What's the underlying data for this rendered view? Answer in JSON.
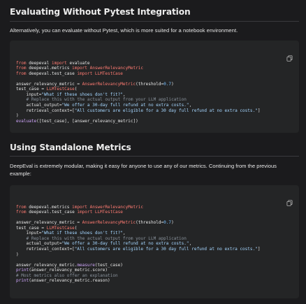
{
  "section1": {
    "title": "Evaluating Without Pytest Integration",
    "description": "Alternatively, you can evaluate without Pytest, which is more suited for a notebook environment.",
    "code": [
      [
        [
          "kw",
          "from"
        ],
        [
          "pl",
          " deepeval "
        ],
        [
          "kw",
          "import"
        ],
        [
          "pl",
          " evaluate"
        ]
      ],
      [
        [
          "kw",
          "from"
        ],
        [
          "pl",
          " deepeval.metrics "
        ],
        [
          "kw",
          "import"
        ],
        [
          "cls",
          " AnswerRelevancyMetric"
        ]
      ],
      [
        [
          "kw",
          "from"
        ],
        [
          "pl",
          " deepeval.test_case "
        ],
        [
          "kw",
          "import"
        ],
        [
          "cls",
          " LLMTestCase"
        ]
      ],
      [],
      [
        [
          "pl",
          "answer_relevancy_metric "
        ],
        [
          "op",
          "="
        ],
        [
          "cls",
          " AnswerRelevancyMetric"
        ],
        [
          "pl",
          "(threshold"
        ],
        [
          "op",
          "="
        ],
        [
          "num",
          "0.7"
        ],
        [
          "pl",
          ")"
        ]
      ],
      [
        [
          "pl",
          "test_case "
        ],
        [
          "op",
          "="
        ],
        [
          "cls",
          " LLMTestCase"
        ],
        [
          "pl",
          "("
        ]
      ],
      [
        [
          "pl",
          "    input"
        ],
        [
          "op",
          "="
        ],
        [
          "str",
          "\"What if these shoes don't fit?\""
        ],
        [
          "pl",
          ","
        ]
      ],
      [
        [
          "cm",
          "    # Replace this with the actual output from your LLM application"
        ]
      ],
      [
        [
          "pl",
          "    actual_output"
        ],
        [
          "op",
          "="
        ],
        [
          "str",
          "\"We offer a 30-day full refund at no extra costs.\""
        ],
        [
          "pl",
          ","
        ]
      ],
      [
        [
          "pl",
          "    retrieval_context"
        ],
        [
          "op",
          "="
        ],
        [
          "pl",
          "["
        ],
        [
          "str",
          "\"All customers are eligible for a 30 day full refund at no extra costs.\""
        ],
        [
          "pl",
          "]"
        ]
      ],
      [
        [
          "pl",
          ")"
        ]
      ],
      [
        [
          "fn",
          "evaluate"
        ],
        [
          "pl",
          "([test_case], [answer_relevancy_metric])"
        ]
      ]
    ]
  },
  "section2": {
    "title": "Using Standalone Metrics",
    "description": "DeepEval is extremely modular, making it easy for anyone to use any of our metrics. Continuing from the previous example:",
    "code": [
      [
        [
          "kw",
          "from"
        ],
        [
          "pl",
          " deepeval.metrics "
        ],
        [
          "kw",
          "import"
        ],
        [
          "cls",
          " AnswerRelevancyMetric"
        ]
      ],
      [
        [
          "kw",
          "from"
        ],
        [
          "pl",
          " deepeval.test_case "
        ],
        [
          "kw",
          "import"
        ],
        [
          "cls",
          " LLMTestCase"
        ]
      ],
      [],
      [
        [
          "pl",
          "answer_relevancy_metric "
        ],
        [
          "op",
          "="
        ],
        [
          "cls",
          " AnswerRelevancyMetric"
        ],
        [
          "pl",
          "(threshold"
        ],
        [
          "op",
          "="
        ],
        [
          "num",
          "0.7"
        ],
        [
          "pl",
          ")"
        ]
      ],
      [
        [
          "pl",
          "test_case "
        ],
        [
          "op",
          "="
        ],
        [
          "cls",
          " LLMTestCase"
        ],
        [
          "pl",
          "("
        ]
      ],
      [
        [
          "pl",
          "    input"
        ],
        [
          "op",
          "="
        ],
        [
          "str",
          "\"What if these shoes don't fit?\""
        ],
        [
          "pl",
          ","
        ]
      ],
      [
        [
          "cm",
          "    # Replace this with the actual output from your LLM application"
        ]
      ],
      [
        [
          "pl",
          "    actual_output"
        ],
        [
          "op",
          "="
        ],
        [
          "str",
          "\"We offer a 30-day full refund at no extra costs.\""
        ],
        [
          "pl",
          ","
        ]
      ],
      [
        [
          "pl",
          "    retrieval_context"
        ],
        [
          "op",
          "="
        ],
        [
          "pl",
          "["
        ],
        [
          "str",
          "\"All customers are eligible for a 30 day full refund at no extra costs.\""
        ],
        [
          "pl",
          "]"
        ]
      ],
      [
        [
          "pl",
          ")"
        ]
      ],
      [],
      [
        [
          "pl",
          "answer_relevancy_metric."
        ],
        [
          "fn",
          "measure"
        ],
        [
          "pl",
          "(test_case)"
        ]
      ],
      [
        [
          "fn",
          "print"
        ],
        [
          "pl",
          "(answer_relevancy_metric.score)"
        ]
      ],
      [
        [
          "cm",
          "# Most metrics also offer an explanation"
        ]
      ],
      [
        [
          "fn",
          "print"
        ],
        [
          "pl",
          "(answer_relevancy_metric.reason)"
        ]
      ]
    ]
  },
  "icons": {
    "copy": "copy-icon"
  },
  "colors": {
    "background": "#1b1b1d",
    "code_background": "#242526",
    "keyword": "#ff7b72",
    "function": "#d2a8ff",
    "string": "#a5d6ff",
    "number": "#79c0ff",
    "comment": "#8b949e"
  }
}
